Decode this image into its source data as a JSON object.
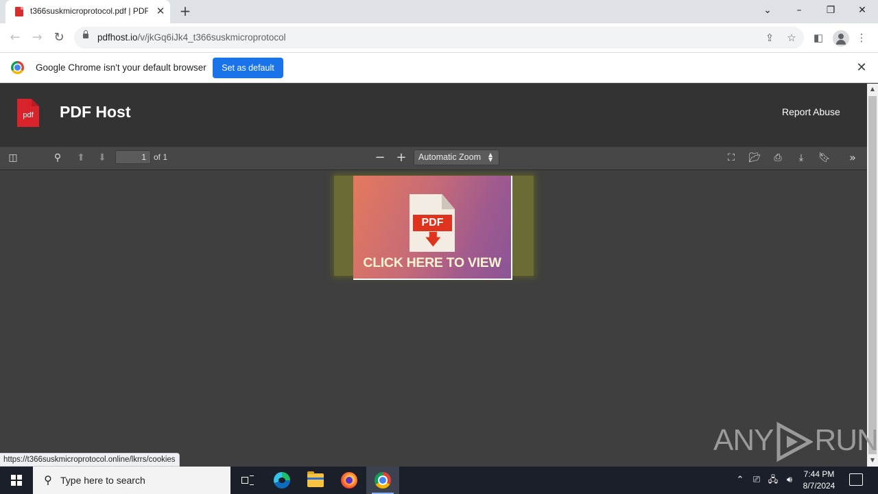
{
  "browser": {
    "tab": {
      "title": "t366suskmicroprotocol.pdf | PDF Host",
      "close": "✕"
    },
    "new_tab": "+",
    "window_controls": {
      "dropdown": "⌄",
      "minimize": "–",
      "restore": "❐",
      "close": "✕"
    },
    "url": {
      "host": "pdfhost.io",
      "path": "/v/jkGq6iJk4_t366suskmicroprotocol"
    },
    "infobar": {
      "message": "Google Chrome isn't your default browser",
      "button": "Set as default",
      "close": "✕"
    }
  },
  "site": {
    "logo_text": "pdf",
    "title": "PDF Host",
    "report_link": "Report Abuse"
  },
  "pdf_toolbar": {
    "page_number": "1",
    "page_count": "of 1",
    "zoom": "Automatic Zoom"
  },
  "pdf_page": {
    "badge": "PDF",
    "cta": "CLICK HERE TO VIEW"
  },
  "status_url": "https://t366suskmicroprotocol.online/lkrrs/cookies",
  "watermark": {
    "left": "ANY",
    "right": "RUN"
  },
  "taskbar": {
    "search_placeholder": "Type here to search",
    "time": "7:44 PM",
    "date": "8/7/2024"
  },
  "colors": {
    "accent": "#1a73e8",
    "header_bg": "#333333",
    "pdf_red": "#d8232a",
    "viewer_bg": "#3f3f3f",
    "taskbar_bg": "#1b1f2a"
  }
}
